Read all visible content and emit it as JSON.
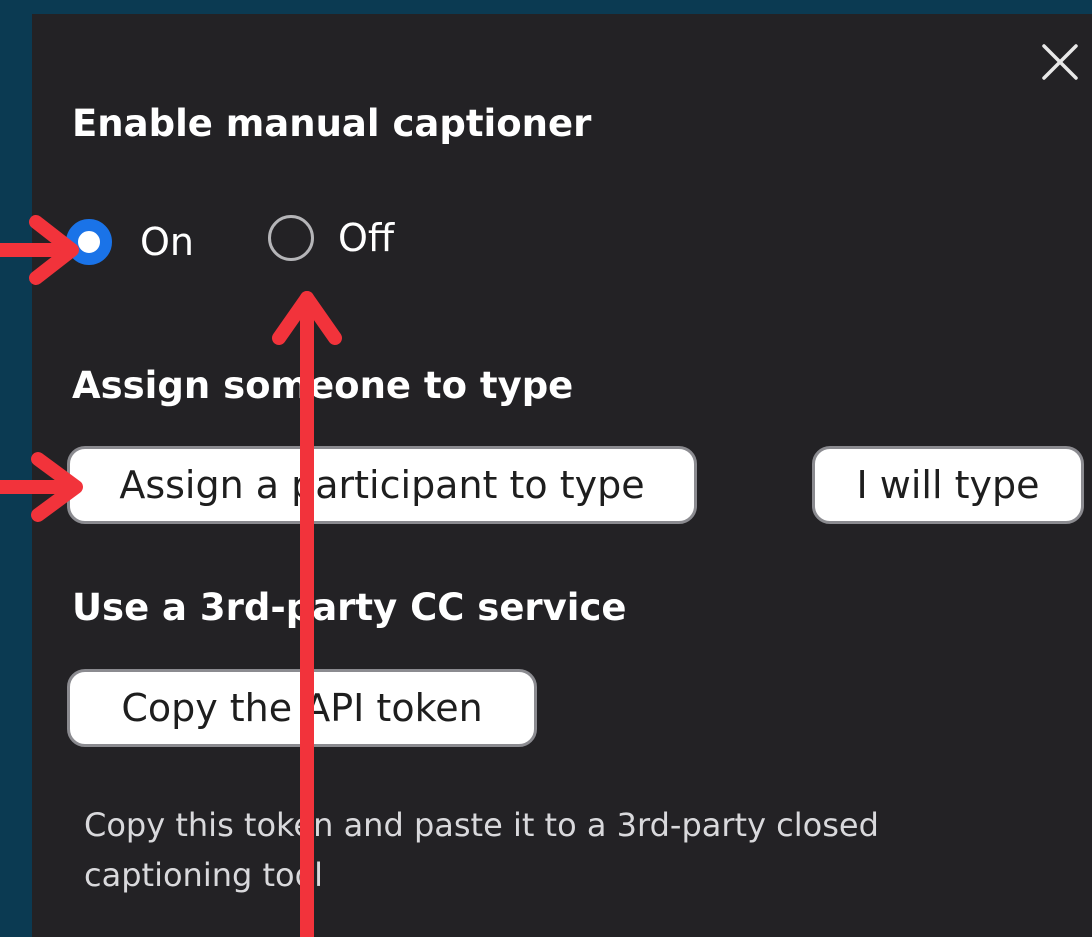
{
  "dialog": {
    "close_label": "close",
    "enable_heading": "Enable manual captioner",
    "radio_on_label": "On",
    "radio_off_label": "Off",
    "radio_selected": "On",
    "assign_heading": "Assign someone to type",
    "assign_participant_button": "Assign a participant to type",
    "i_will_type_button": "I will type",
    "third_party_heading": "Use a 3rd-party CC service",
    "copy_token_button": "Copy the API token",
    "token_help_text": "Copy this token and paste it to a 3rd-party closed captioning tool"
  },
  "colors": {
    "panel_background": "#232225",
    "page_background": "#0b3a52",
    "radio_selected": "#1a73e8",
    "annotation_arrow": "#f2333b",
    "text_primary": "#ffffff",
    "text_secondary": "#d9d9dc"
  },
  "icons": {
    "close": "close-icon"
  }
}
